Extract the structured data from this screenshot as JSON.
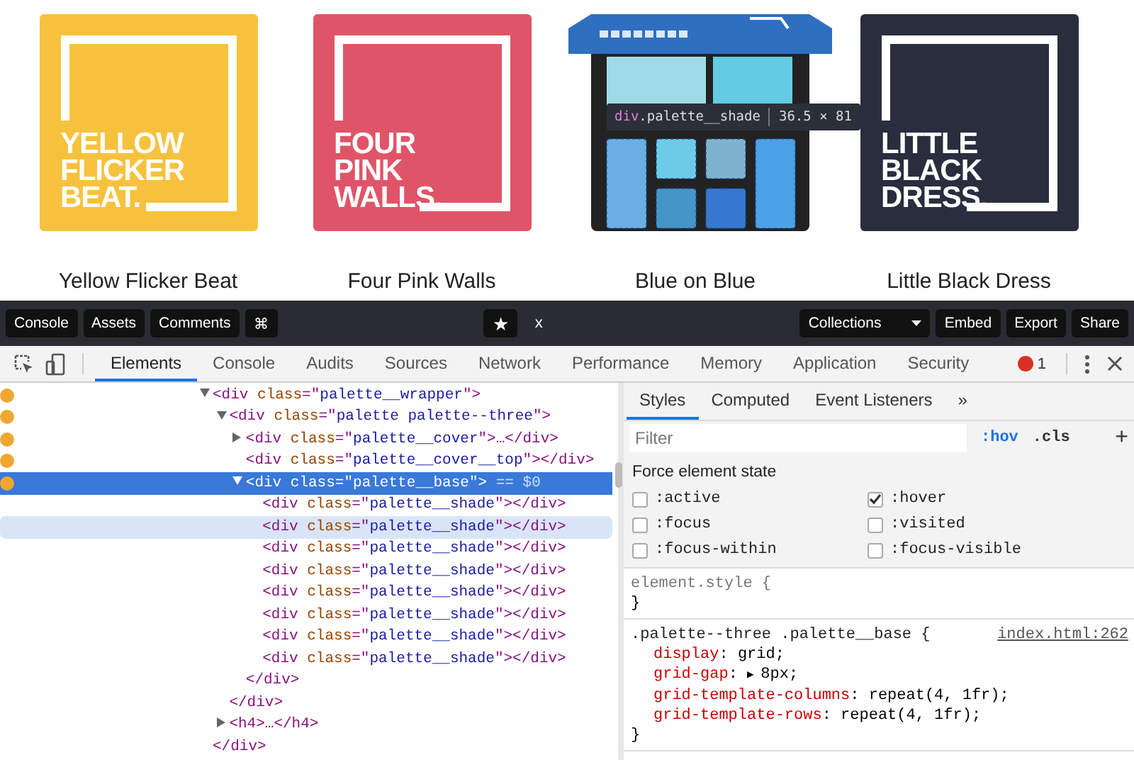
{
  "palettes": [
    {
      "kind": "cover",
      "color": "#f6c23e",
      "lines": [
        "YELLOW",
        "FLICKER",
        "BEAT."
      ],
      "caption": "Yellow Flicker Beat"
    },
    {
      "kind": "cover",
      "color": "#e05468",
      "lines": [
        "FOUR",
        "PINK",
        "WALLS."
      ],
      "caption": "Four Pink Walls"
    },
    {
      "kind": "open",
      "color": "#2f6fc0",
      "tooltip": {
        "tag": "div",
        "cls": ".palette__shade",
        "size": "36.5 × 81"
      },
      "caption": "Blue on Blue"
    },
    {
      "kind": "cover",
      "color": "#2a2d3e",
      "lines": [
        "LITTLE",
        "BLACK",
        "DRESS."
      ],
      "caption": "Little Black Dress"
    }
  ],
  "toolbar": {
    "left": [
      {
        "label": "Console"
      },
      {
        "label": "Assets"
      },
      {
        "label": "Comments"
      },
      {
        "label": "⌘"
      }
    ],
    "star": "★",
    "close": "x",
    "dropdown": "Collections",
    "right": [
      {
        "label": "Embed"
      },
      {
        "label": "Export"
      },
      {
        "label": "Share"
      }
    ]
  },
  "devtools_tabs": [
    {
      "label": "Elements",
      "selected": true
    },
    {
      "label": "Console",
      "selected": false
    },
    {
      "label": "Audits",
      "selected": false
    },
    {
      "label": "Sources",
      "selected": false
    },
    {
      "label": "Network",
      "selected": false
    },
    {
      "label": "Performance",
      "selected": false
    },
    {
      "label": "Memory",
      "selected": false
    },
    {
      "label": "Application",
      "selected": false
    },
    {
      "label": "Security",
      "selected": false
    }
  ],
  "error_count": "1",
  "dom_tree": [
    {
      "dot": true,
      "selected": false,
      "hovered": false,
      "expanded": true,
      "line": [
        {
          "kind": "tag",
          "text": "<div "
        },
        {
          "kind": "attr",
          "text": "class"
        },
        {
          "kind": "tag",
          "text": "=\""
        },
        {
          "kind": "value",
          "text": "palette__wrapper"
        },
        {
          "kind": "tag",
          "text": "\">"
        }
      ],
      "close": "</div>",
      "children": [
        {
          "dot": true,
          "selected": false,
          "hovered": false,
          "expanded": true,
          "line": [
            {
              "kind": "tag",
              "text": "<div "
            },
            {
              "kind": "attr",
              "text": "class"
            },
            {
              "kind": "tag",
              "text": "=\""
            },
            {
              "kind": "value",
              "text": "palette palette--three"
            },
            {
              "kind": "tag",
              "text": "\">"
            }
          ],
          "close": "</div>",
          "children": [
            {
              "dot": true,
              "selected": false,
              "hovered": false,
              "expanded": false,
              "line": [
                {
                  "kind": "tag",
                  "text": "<div "
                },
                {
                  "kind": "attr",
                  "text": "class"
                },
                {
                  "kind": "tag",
                  "text": "=\""
                },
                {
                  "kind": "value",
                  "text": "palette__cover"
                },
                {
                  "kind": "tag",
                  "text": "\">…</div>"
                }
              ]
            },
            {
              "dot": true,
              "selected": false,
              "hovered": false,
              "line": [
                {
                  "kind": "tag",
                  "text": "<div "
                },
                {
                  "kind": "attr",
                  "text": "class"
                },
                {
                  "kind": "tag",
                  "text": "=\""
                },
                {
                  "kind": "value",
                  "text": "palette__cover__top"
                },
                {
                  "kind": "tag",
                  "text": "\"></div>"
                }
              ]
            },
            {
              "dot": true,
              "selected": true,
              "hovered": false,
              "expanded": true,
              "line": [
                {
                  "kind": "tag",
                  "text": "<div "
                },
                {
                  "kind": "attr",
                  "text": "class"
                },
                {
                  "kind": "tag",
                  "text": "=\""
                },
                {
                  "kind": "value",
                  "text": "palette__base"
                },
                {
                  "kind": "tag",
                  "text": "\">"
                },
                {
                  "kind": "note",
                  "text": " == $0"
                }
              ],
              "close": "</div>",
              "children": [
                {
                  "dot": false,
                  "selected": false,
                  "hovered": false,
                  "line": [
                    {
                      "kind": "tag",
                      "text": "<div "
                    },
                    {
                      "kind": "attr",
                      "text": "class"
                    },
                    {
                      "kind": "tag",
                      "text": "=\""
                    },
                    {
                      "kind": "value",
                      "text": "palette__shade"
                    },
                    {
                      "kind": "tag",
                      "text": "\"></div>"
                    }
                  ]
                },
                {
                  "dot": false,
                  "selected": false,
                  "hovered": true,
                  "line": [
                    {
                      "kind": "tag",
                      "text": "<div "
                    },
                    {
                      "kind": "attr",
                      "text": "class"
                    },
                    {
                      "kind": "tag",
                      "text": "=\""
                    },
                    {
                      "kind": "value",
                      "text": "palette__shade"
                    },
                    {
                      "kind": "tag",
                      "text": "\"></div>"
                    }
                  ]
                },
                {
                  "dot": false,
                  "selected": false,
                  "hovered": false,
                  "line": [
                    {
                      "kind": "tag",
                      "text": "<div "
                    },
                    {
                      "kind": "attr",
                      "text": "class"
                    },
                    {
                      "kind": "tag",
                      "text": "=\""
                    },
                    {
                      "kind": "value",
                      "text": "palette__shade"
                    },
                    {
                      "kind": "tag",
                      "text": "\"></div>"
                    }
                  ]
                },
                {
                  "dot": false,
                  "selected": false,
                  "hovered": false,
                  "line": [
                    {
                      "kind": "tag",
                      "text": "<div "
                    },
                    {
                      "kind": "attr",
                      "text": "class"
                    },
                    {
                      "kind": "tag",
                      "text": "=\""
                    },
                    {
                      "kind": "value",
                      "text": "palette__shade"
                    },
                    {
                      "kind": "tag",
                      "text": "\"></div>"
                    }
                  ]
                },
                {
                  "dot": false,
                  "selected": false,
                  "hovered": false,
                  "line": [
                    {
                      "kind": "tag",
                      "text": "<div "
                    },
                    {
                      "kind": "attr",
                      "text": "class"
                    },
                    {
                      "kind": "tag",
                      "text": "=\""
                    },
                    {
                      "kind": "value",
                      "text": "palette__shade"
                    },
                    {
                      "kind": "tag",
                      "text": "\"></div>"
                    }
                  ]
                },
                {
                  "dot": false,
                  "selected": false,
                  "hovered": false,
                  "line": [
                    {
                      "kind": "tag",
                      "text": "<div "
                    },
                    {
                      "kind": "attr",
                      "text": "class"
                    },
                    {
                      "kind": "tag",
                      "text": "=\""
                    },
                    {
                      "kind": "value",
                      "text": "palette__shade"
                    },
                    {
                      "kind": "tag",
                      "text": "\"></div>"
                    }
                  ]
                },
                {
                  "dot": false,
                  "selected": false,
                  "hovered": false,
                  "line": [
                    {
                      "kind": "tag",
                      "text": "<div "
                    },
                    {
                      "kind": "attr",
                      "text": "class"
                    },
                    {
                      "kind": "tag",
                      "text": "=\""
                    },
                    {
                      "kind": "value",
                      "text": "palette__shade"
                    },
                    {
                      "kind": "tag",
                      "text": "\"></div>"
                    }
                  ]
                },
                {
                  "dot": false,
                  "selected": false,
                  "hovered": false,
                  "line": [
                    {
                      "kind": "tag",
                      "text": "<div "
                    },
                    {
                      "kind": "attr",
                      "text": "class"
                    },
                    {
                      "kind": "tag",
                      "text": "=\""
                    },
                    {
                      "kind": "value",
                      "text": "palette__shade"
                    },
                    {
                      "kind": "tag",
                      "text": "\"></div>"
                    }
                  ]
                }
              ]
            }
          ]
        },
        {
          "dot": false,
          "selected": false,
          "hovered": false,
          "expanded": false,
          "line": [
            {
              "kind": "tag",
              "text": "<h4>…</h4>"
            }
          ]
        }
      ]
    }
  ],
  "styles_tabs": [
    {
      "label": "Styles",
      "selected": true
    },
    {
      "label": "Computed",
      "selected": false
    },
    {
      "label": "Event Listeners",
      "selected": false
    }
  ],
  "styles_more": "»",
  "filter": {
    "placeholder": "Filter"
  },
  "hov": {
    "label": ":hov",
    "on": true
  },
  "cls": ".cls",
  "add": "+",
  "force_state": {
    "title": "Force element state",
    "options": [
      {
        "label": ":active",
        "checked": false
      },
      {
        "label": ":hover",
        "checked": true
      },
      {
        "label": ":focus",
        "checked": false
      },
      {
        "label": ":visited",
        "checked": false
      },
      {
        "label": ":focus-within",
        "checked": false
      },
      {
        "label": ":focus-visible",
        "checked": false
      }
    ]
  },
  "rules": [
    {
      "selector": "element.style {",
      "close": "}"
    },
    {
      "selector": ".palette--three .palette__base {",
      "source": "index.html:262",
      "close": "}",
      "props": [
        {
          "name": "display",
          "colon": ":",
          "value": "grid;"
        },
        {
          "name": "grid-gap",
          "colon": ":",
          "expander": "▶",
          "value": "8px;"
        },
        {
          "name": "grid-template-columns",
          "colon": ":",
          "value": "repeat(4, 1fr);"
        },
        {
          "name": "grid-template-rows",
          "colon": ":",
          "value": "repeat(4, 1fr);"
        }
      ]
    }
  ]
}
